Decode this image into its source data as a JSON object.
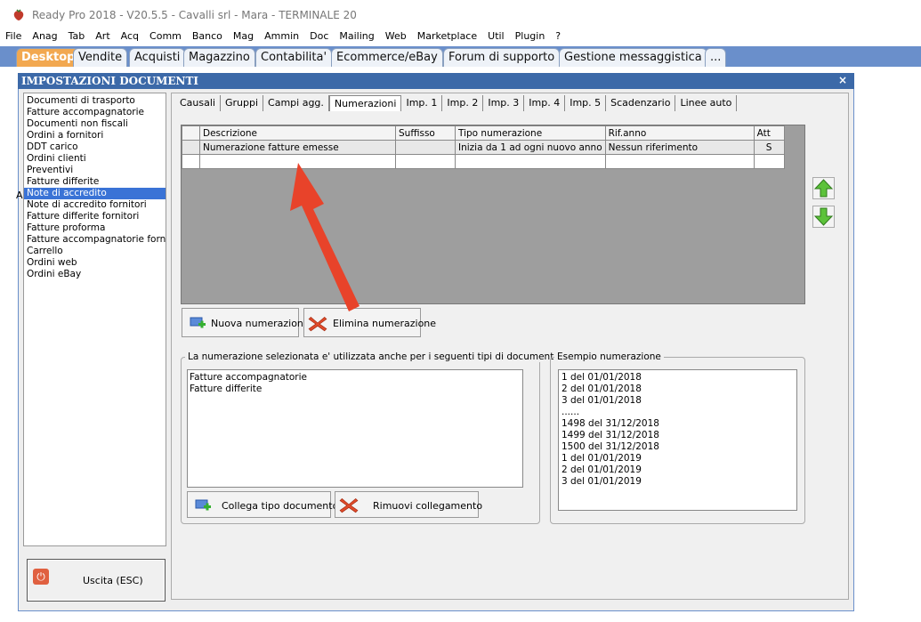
{
  "window_title": "Ready Pro 2018 - V20.5.5 - Cavalli srl - Mara - TERMINALE 20",
  "menu": [
    "File",
    "Anag",
    "Tab",
    "Art",
    "Acq",
    "Comm",
    "Banco",
    "Mag",
    "Ammin",
    "Doc",
    "Mailing",
    "Web",
    "Marketplace",
    "Util",
    "Plugin",
    "?"
  ],
  "app_tabs": [
    "Desktop",
    "Vendite",
    "Acquisti",
    "Magazzino",
    "Contabilita'",
    "Ecommerce/eBay",
    "Forum di supporto",
    "Gestione messaggistica",
    "..."
  ],
  "dialog": {
    "title": "IMPOSTAZIONI DOCUMENTI",
    "close": "×",
    "stray_char": "A"
  },
  "doc_types": [
    "Documenti di trasporto",
    "Fatture accompagnatorie",
    "Documenti non fiscali",
    "Ordini a fornitori",
    "DDT carico",
    "Ordini clienti",
    "Preventivi",
    "Fatture differite",
    "Note di accredito",
    "Note di accredito fornitori",
    "Fatture differite fornitori",
    "Fatture proforma",
    "Fatture accompagnatorie fornito",
    "Carrello",
    "Ordini web",
    "Ordini eBay"
  ],
  "selected_doc_type": "Note di accredito",
  "exit_button": "Uscita (ESC)",
  "tabs": [
    "Causali",
    "Gruppi",
    "Campi agg.",
    "Numerazioni",
    "Imp. 1",
    "Imp. 2",
    "Imp. 3",
    "Imp. 4",
    "Imp. 5",
    "Scadenzario",
    "Linee auto"
  ],
  "active_tab": "Numerazioni",
  "grid": {
    "headers": [
      "Descrizione",
      "Suffisso",
      "Tipo numerazione",
      "Rif.anno",
      "Att"
    ],
    "rows": [
      [
        "Numerazione fatture emesse",
        "",
        "Inizia da 1 ad ogni nuovo anno",
        "Nessun riferimento",
        "S"
      ]
    ]
  },
  "buttons": {
    "nuova": "Nuova numerazione",
    "elimina": "Elimina numerazione",
    "collega": "Collega tipo documento",
    "rimuovi": "Rimuovi collegamento"
  },
  "linked_group": {
    "title": "La numerazione selezionata e' utilizzata anche per i seguenti tipi di documenti...",
    "items": [
      "Fatture accompagnatorie",
      "Fatture differite"
    ]
  },
  "example_group": {
    "title": "Esempio numerazione",
    "items": [
      "1 del 01/01/2018",
      "2 del 01/01/2018",
      "3 del 01/01/2018",
      "......",
      "1498 del 31/12/2018",
      "1499 del 31/12/2018",
      "1500 del 31/12/2018",
      "1 del 01/01/2019",
      "2 del 01/01/2019",
      "3 del 01/01/2019"
    ]
  },
  "colors": {
    "accent_tab": "#f2a850",
    "tabbar": "#6a8fcb",
    "dialog_title": "#3c69a8",
    "selection": "#3a73d6",
    "annotation_arrow": "#e8432a"
  }
}
